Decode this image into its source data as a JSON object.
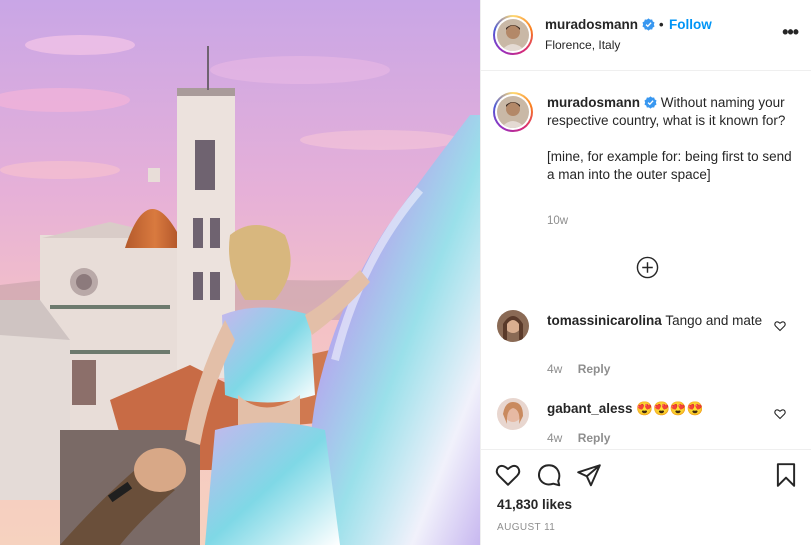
{
  "post": {
    "username": "muradosmann",
    "follow_label": "Follow",
    "separator": "•",
    "location": "Florence, Italy",
    "more_icon": "more-horizontal-icon",
    "caption": {
      "username": "muradosmann",
      "line1": "Without naming your respective country, what is it known for?",
      "line2": "[mine, for example for: being first to send a man into the outer space]",
      "time": "10w"
    },
    "load_more_icon": "plus-circle-icon",
    "comments": [
      {
        "username": "tomassinicarolina",
        "text": "Tango and mate",
        "time": "4w",
        "reply": "Reply"
      },
      {
        "username": "gabant_aless",
        "text": "😍😍😍😍",
        "time": "4w",
        "reply": "Reply"
      }
    ],
    "likes": "41,830 likes",
    "date": "AUGUST 11",
    "colors": {
      "accent": "#0095f6",
      "text": "#262626",
      "muted": "#8e8e8e",
      "border": "#efefef"
    }
  }
}
